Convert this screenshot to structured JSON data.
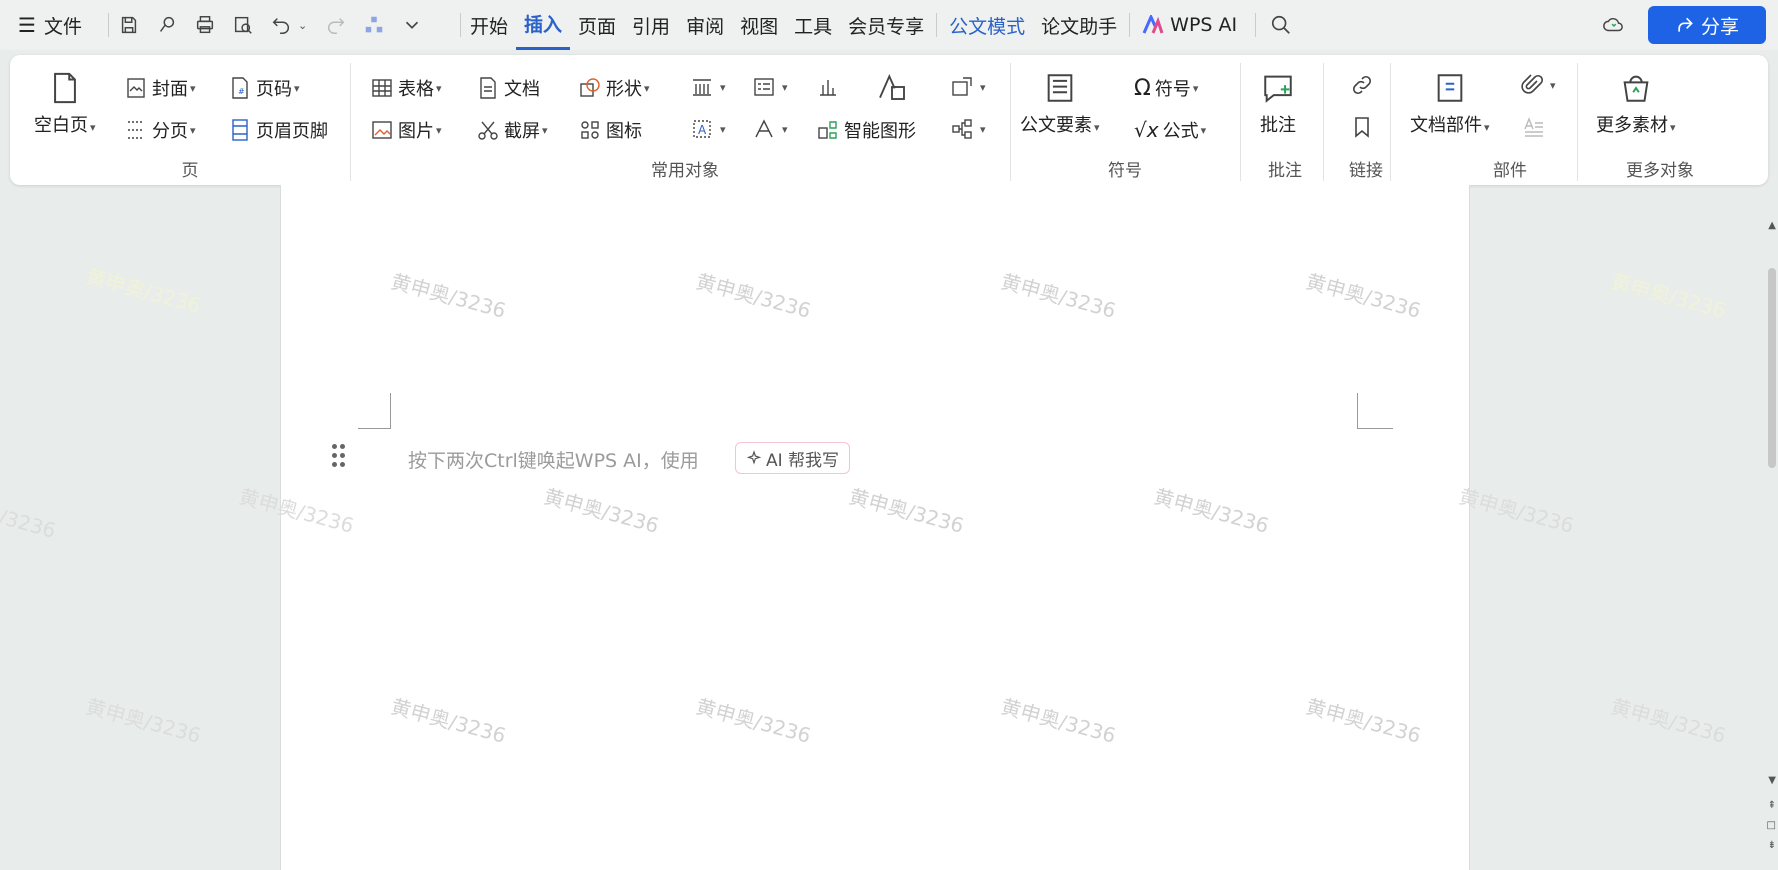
{
  "topbar": {
    "file_label": "文件",
    "tabs": [
      {
        "label": "开始"
      },
      {
        "label": "插入"
      },
      {
        "label": "页面"
      },
      {
        "label": "引用"
      },
      {
        "label": "审阅"
      },
      {
        "label": "视图"
      },
      {
        "label": "工具"
      },
      {
        "label": "会员专享"
      },
      {
        "label": "公文模式"
      },
      {
        "label": "论文助手"
      },
      {
        "label": "WPS AI"
      }
    ],
    "share_label": "分享"
  },
  "ribbon": {
    "page_group": {
      "blank_page": "空白页",
      "cover": "封面",
      "page_number": "页码",
      "page_break": "分页",
      "header_footer": "页眉页脚",
      "label": "页"
    },
    "common_group": {
      "table": "表格",
      "document": "文档",
      "shape": "形状",
      "picture": "图片",
      "screenshot": "截屏",
      "icon": "图标",
      "smart_art": "智能图形",
      "label": "常用对象"
    },
    "symbol_group": {
      "official_elements": "公文要素",
      "symbol": "符号",
      "formula": "公式",
      "label": "符号"
    },
    "comment_group": {
      "comment": "批注",
      "label": "批注"
    },
    "link_group": {
      "label": "链接"
    },
    "parts_group": {
      "doc_parts": "文档部件",
      "label": "部件"
    },
    "more_group": {
      "more_material": "更多素材",
      "label": "更多对象"
    }
  },
  "document": {
    "hint": "按下两次Ctrl键唤起WPS AI，使用",
    "ai_button": "AI 帮我写",
    "watermark": "黄申奥/3236"
  },
  "colors": {
    "accent": "#2b62c9",
    "share_bg": "#1e63e6",
    "background": "#e8eceb"
  }
}
